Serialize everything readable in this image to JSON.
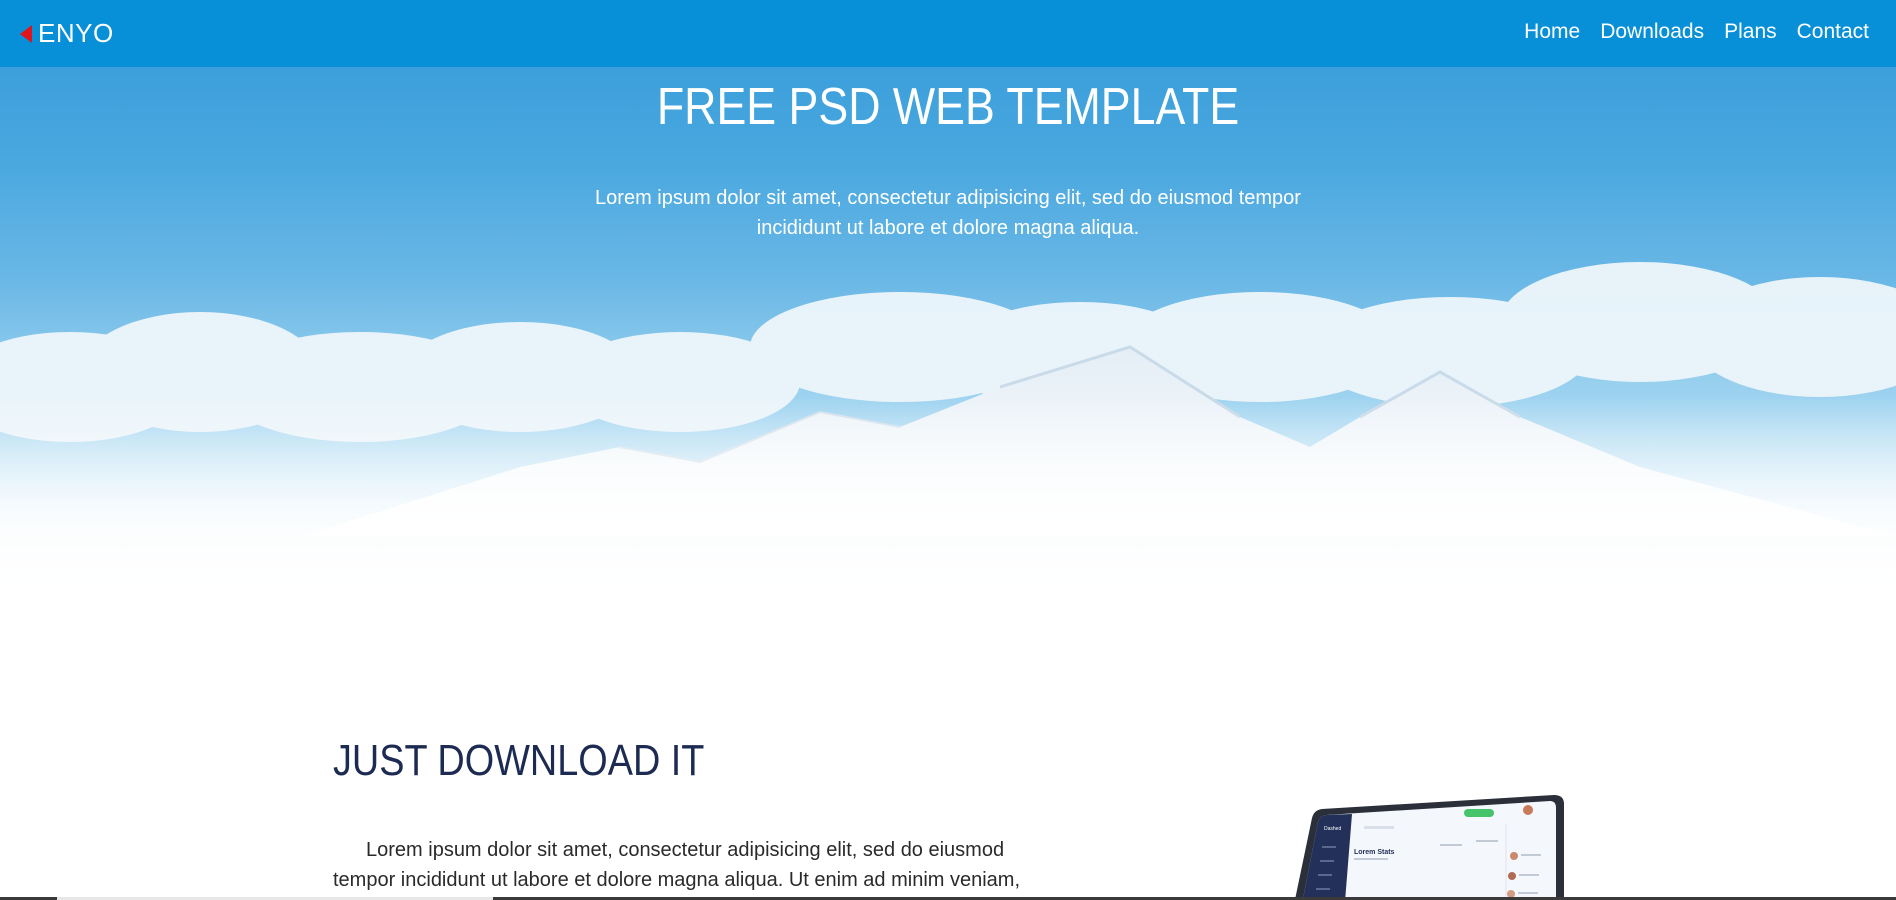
{
  "nav": {
    "brand": "ENYO",
    "links": [
      "Home",
      "Downloads",
      "Plans",
      "Contact"
    ]
  },
  "hero": {
    "title": "FREE PSD WEB TEMPLATE",
    "subtitle_line1": "Lorem ipsum dolor sit amet, consectetur adipisicing elit, sed do eiusmod tempor",
    "subtitle_line2": "incididunt ut labore et dolore magna aliqua."
  },
  "download": {
    "title": "JUST DOWNLOAD IT",
    "body": "Lorem ipsum dolor sit amet, consectetur adipisicing elit, sed do eiusmod tempor incididunt ut labore et dolore magna aliqua. Ut enim ad minim veniam,"
  },
  "laptop_screen": {
    "app_label": "Dashed",
    "heading": "Lorem Stats"
  },
  "colors": {
    "navbar": "#0790d8",
    "brand_icon": "#e0141b",
    "heading_dark": "#1d2b52"
  }
}
